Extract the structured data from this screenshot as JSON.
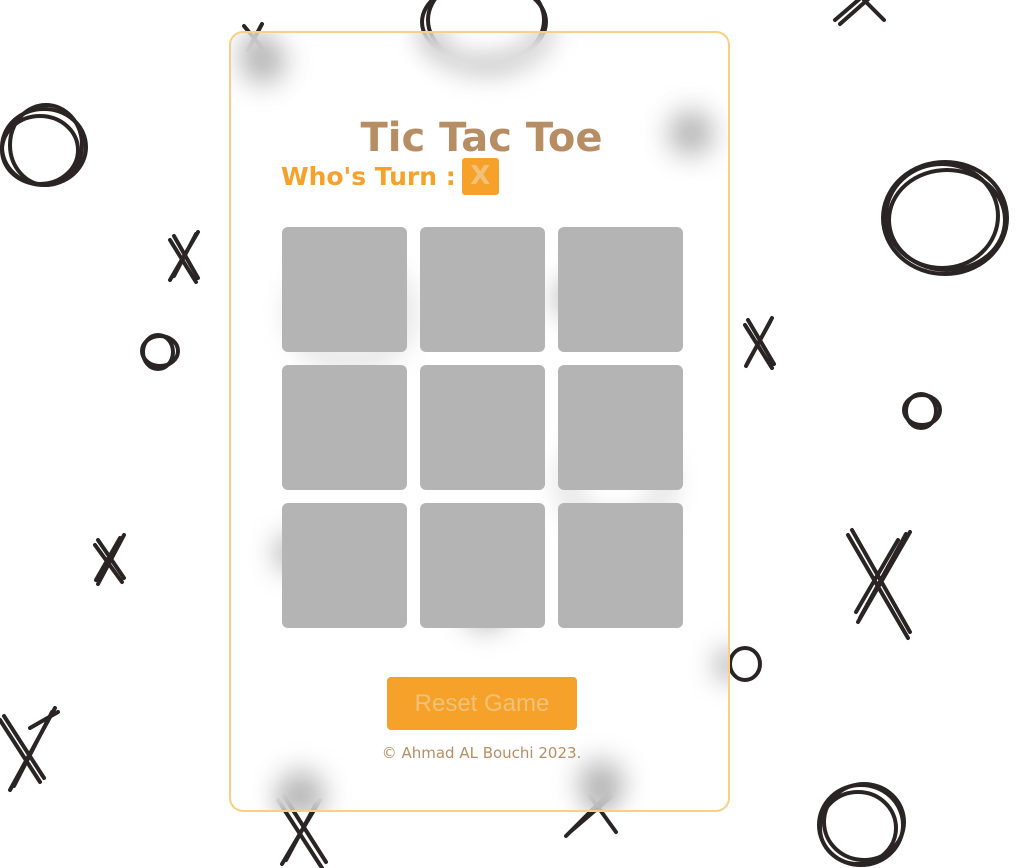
{
  "game": {
    "title": "Tic Tac Toe",
    "turn_label": "Who's Turn :",
    "current_player": "X",
    "board": [
      "",
      "",
      "",
      "",
      "",
      "",
      "",
      "",
      ""
    ],
    "reset_label": "Reset Game",
    "footer": "© Ahmad AL Bouchi 2023."
  },
  "colors": {
    "accent": "#f6a12a",
    "title": "#b78d64",
    "cell": "#b4b4b4",
    "card_border": "#f8cf86"
  }
}
